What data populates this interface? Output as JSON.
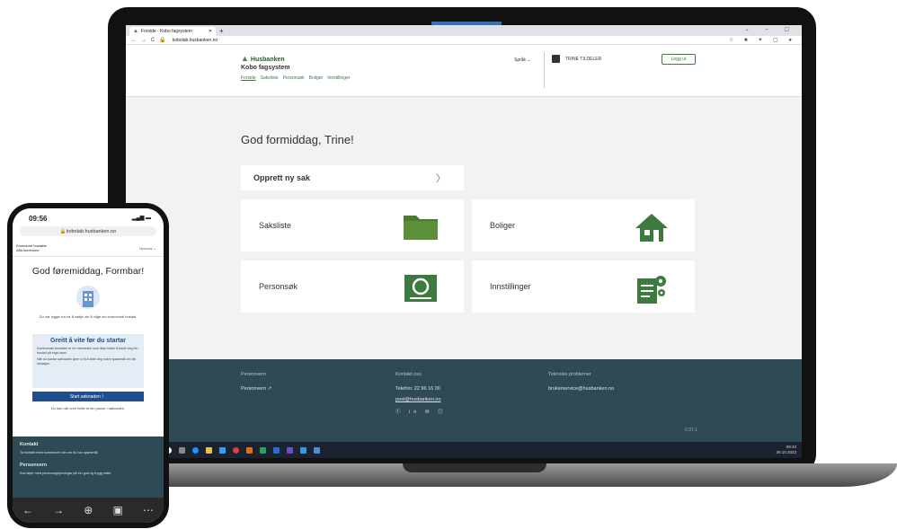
{
  "browser": {
    "tab_title": "Forside - Kobo fagsystem",
    "url": "kobolab.husbanken.no"
  },
  "header": {
    "logo_text": "Husbanken",
    "system_name": "Kobo fagsystem",
    "nav": [
      "Forside",
      "Saksliste",
      "Personsøk",
      "Boliger",
      "Innstillinger"
    ],
    "language_label": "Språk",
    "user_name": "TRINE TILDELER",
    "logout_label": "Logg ut"
  },
  "main": {
    "greeting": "God formiddag, Trine!",
    "new_case_label": "Opprett ny sak",
    "cards": [
      {
        "label": "Saksliste",
        "icon": "folder-icon"
      },
      {
        "label": "Boliger",
        "icon": "house-icon"
      },
      {
        "label": "Personsøk",
        "icon": "search-icon"
      },
      {
        "label": "Innstillinger",
        "icon": "settings-document-icon"
      }
    ]
  },
  "footer": {
    "privacy_heading": "Personvern",
    "privacy_link": "Personvern",
    "contact_heading": "Kontakt oss",
    "phone": "Telefon: 22 96 16 00",
    "email": "post@husbanken.no",
    "tech_heading": "Tekniske problemer",
    "tech_email": "brukerservice@husbanken.no",
    "version": "0.37.1"
  },
  "taskbar": {
    "time": "09:43",
    "date": "26.10.2022"
  },
  "phone": {
    "time": "09:56",
    "url": "kobolab.husbanken.no",
    "municipality": "Kommune bustøtte\nAlfa kommune",
    "language": "Nynorsk",
    "greeting": "God føremiddag, Formbar!",
    "lead": "Du har logga inn for å søkje om å vilge ein kommunal bustad.",
    "info_title": "Greitt å vite før du startar",
    "info_text_1": "Kommunale bustader er for menneske som ikkje klarer å kaufe seg ein bustad på eiga hand.",
    "info_text_2": "Når du startar søknaden kjem vi til å stille deg nokre spørsmål om din situasjon.",
    "start_label": "Start søknaden",
    "note": "Du kan når som helst ta ein pause i søknaden.",
    "contact_heading": "Kontakt",
    "contact_text": "Ta kontakt med kommunen din om du har spørsmål.",
    "privacy_heading": "Personvern",
    "privacy_text": "Kva skjer med personopplysningar på ein god og trygg måte."
  },
  "colors": {
    "brand_green": "#3c7a3f",
    "footer_bg": "#2e4a55",
    "phone_accent": "#1f4e8c"
  }
}
